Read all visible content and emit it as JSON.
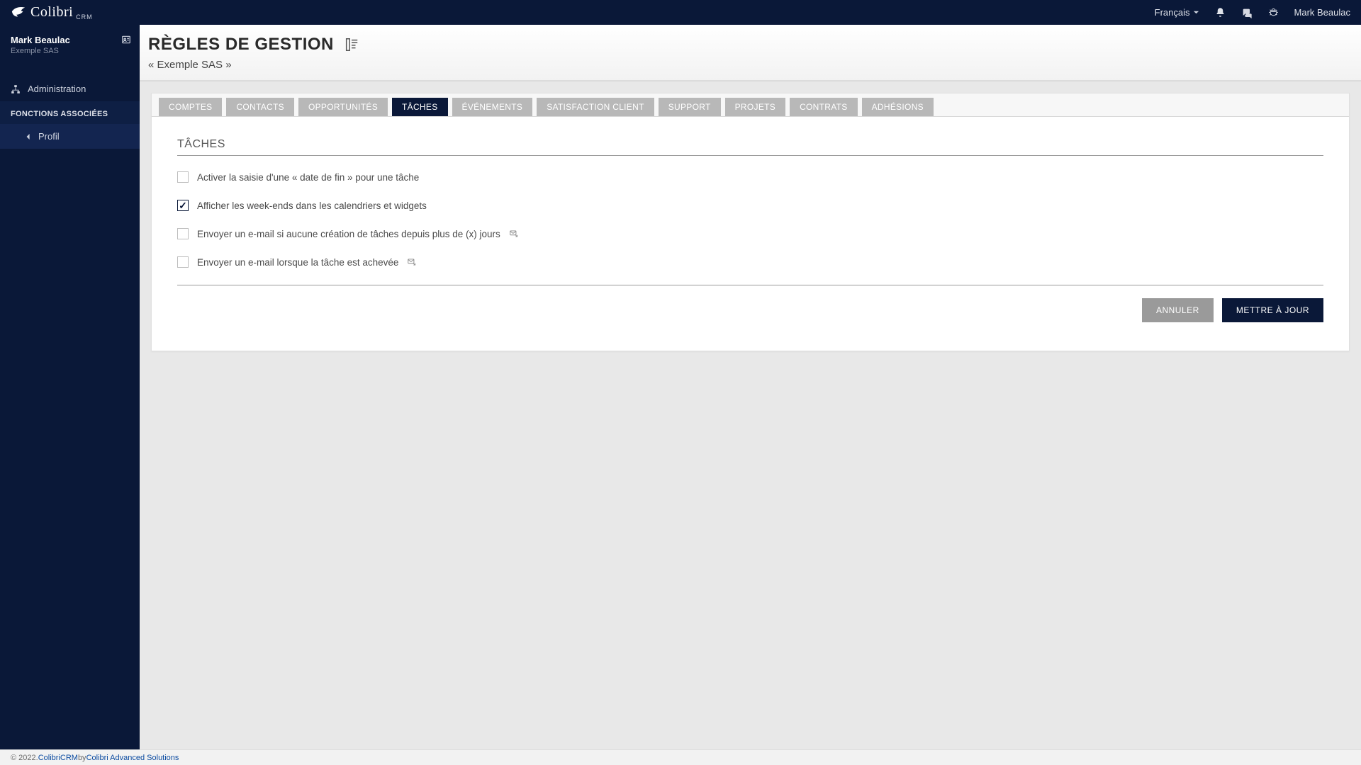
{
  "header": {
    "brand_name": "Colibri",
    "brand_sub": "CRM",
    "language": "Français",
    "user_name": "Mark Beaulac"
  },
  "sidebar": {
    "user": {
      "name": "Mark Beaulac",
      "company": "Exemple SAS"
    },
    "nav": {
      "administration": "Administration"
    },
    "section_title": "FONCTIONS ASSOCIÉES",
    "sub_items": {
      "profil": "Profil"
    }
  },
  "page": {
    "title": "RÈGLES DE GESTION",
    "subtitle": "« Exemple SAS »"
  },
  "tabs": [
    {
      "id": "comptes",
      "label": "COMPTES",
      "active": false
    },
    {
      "id": "contacts",
      "label": "CONTACTS",
      "active": false
    },
    {
      "id": "opportunites",
      "label": "OPPORTUNITÉS",
      "active": false
    },
    {
      "id": "taches",
      "label": "TÂCHES",
      "active": true
    },
    {
      "id": "evenements",
      "label": "ÉVÉNEMENTS",
      "active": false
    },
    {
      "id": "satisfaction",
      "label": "SATISFACTION CLIENT",
      "active": false
    },
    {
      "id": "support",
      "label": "SUPPORT",
      "active": false
    },
    {
      "id": "projets",
      "label": "PROJETS",
      "active": false
    },
    {
      "id": "contrats",
      "label": "CONTRATS",
      "active": false
    },
    {
      "id": "adhesions",
      "label": "ADHÉSIONS",
      "active": false
    }
  ],
  "panel": {
    "title": "TÂCHES",
    "rows": [
      {
        "label": "Activer la saisie d'une « date de fin » pour une tâche",
        "checked": false,
        "info": false
      },
      {
        "label": "Afficher les week-ends dans les calendriers et widgets",
        "checked": true,
        "info": false
      },
      {
        "label": "Envoyer un e-mail si aucune création de tâches depuis plus de (x) jours",
        "checked": false,
        "info": true
      },
      {
        "label": "Envoyer un e-mail lorsque la tâche est achevée",
        "checked": false,
        "info": true
      }
    ],
    "buttons": {
      "cancel": "ANNULER",
      "submit": "METTRE À JOUR"
    }
  },
  "footer": {
    "copyright_prefix": "© 2022. ",
    "product": "ColibriCRM",
    "by": " by ",
    "company": "Colibri Advanced Solutions"
  }
}
